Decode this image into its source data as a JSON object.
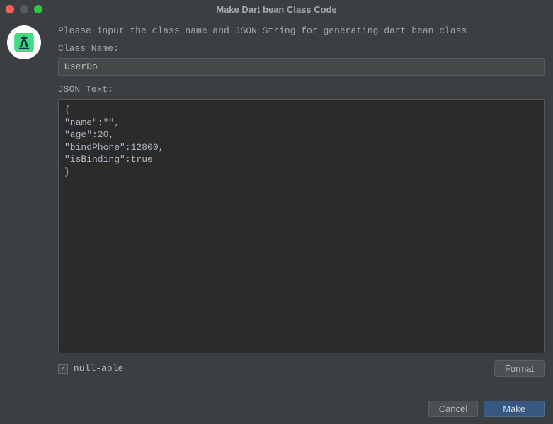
{
  "window": {
    "title": "Make Dart bean Class Code"
  },
  "instruction": "Please input the class name and JSON String for generating dart bean class",
  "labels": {
    "className": "Class Name:",
    "jsonText": "JSON Text:",
    "nullable": "null-able"
  },
  "inputs": {
    "classNameValue": "UserDo",
    "jsonTextValue": "{\n\"name\":\"\",\n\"age\":20,\n\"bindPhone\":12800,\n\"isBinding\":true\n}"
  },
  "buttons": {
    "format": "Format",
    "cancel": "Cancel",
    "make": "Make"
  },
  "checkbox": {
    "nullableChecked": true
  }
}
